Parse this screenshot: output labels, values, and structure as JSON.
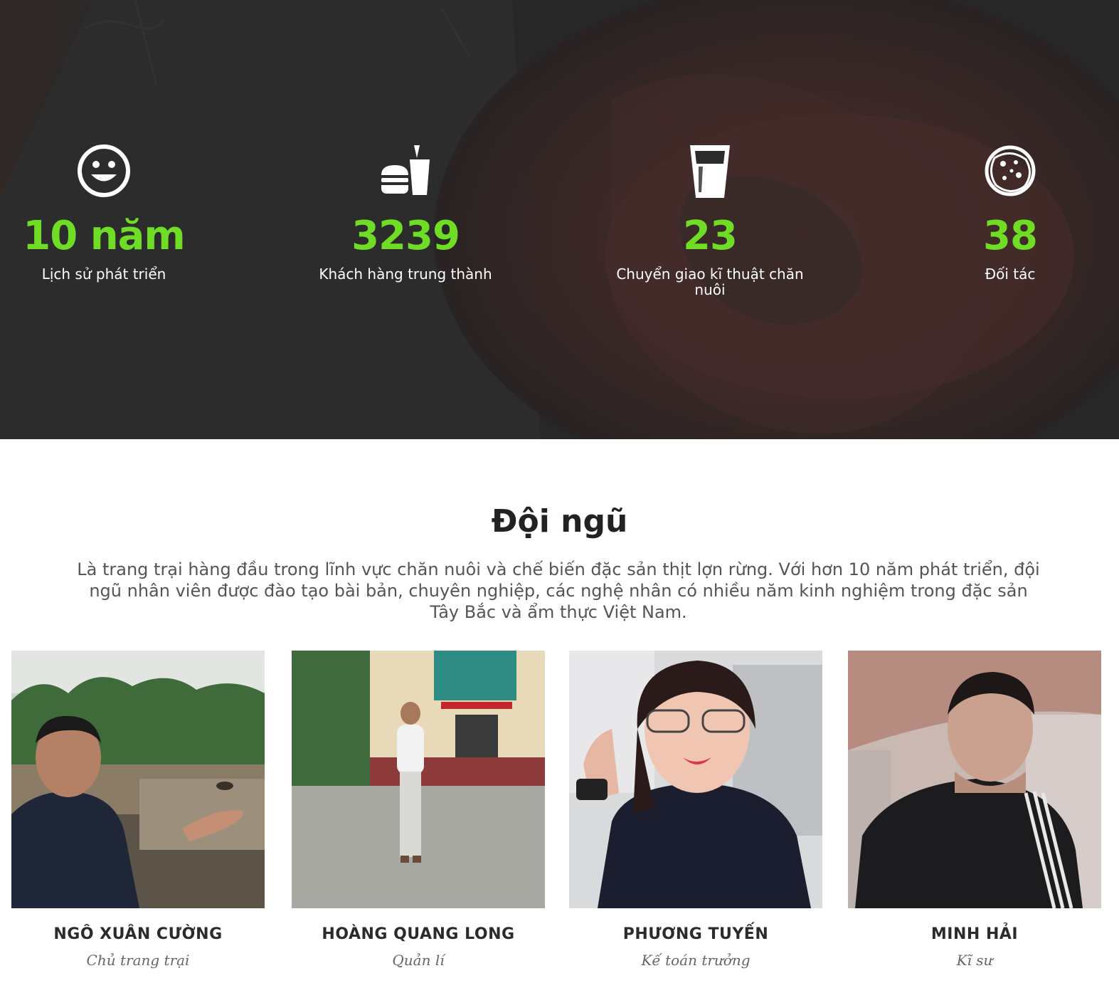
{
  "stats": [
    {
      "icon": "smiley-icon",
      "value": "10 năm",
      "label": "Lịch sử phát triển"
    },
    {
      "icon": "burger-drink-icon",
      "value": "3239",
      "label": "Khách hàng trung thành"
    },
    {
      "icon": "glass-icon",
      "value": "23",
      "label": "Chuyển giao kĩ thuật chăn nuôi"
    },
    {
      "icon": "cookie-icon",
      "value": "38",
      "label": "Đối tác"
    }
  ],
  "team": {
    "title": "Đội ngũ",
    "description": "Là trang trại hàng đầu trong lĩnh vực chăn nuôi và chế biến đặc sản thịt lợn rừng. Với hơn 10 năm phát triển, đội ngũ nhân viên được đào tạo bài bản, chuyên nghiệp, các nghệ nhân có nhiều năm kinh nghiệm trong đặc sản Tây Bắc và ẩm thực Việt Nam.",
    "members": [
      {
        "name": "NGÔ XUÂN CƯỜNG",
        "role": "Chủ trang trại"
      },
      {
        "name": "HOÀNG QUANG LONG",
        "role": "Quản lí"
      },
      {
        "name": "PHƯƠNG TUYẾN",
        "role": "Kế toán trưởng"
      },
      {
        "name": "MINH HẢI",
        "role": "Kĩ sư"
      }
    ]
  },
  "colors": {
    "accent": "#6fdc25",
    "hero_overlay": "#262626",
    "heading": "#222222",
    "body_text": "#555555"
  }
}
